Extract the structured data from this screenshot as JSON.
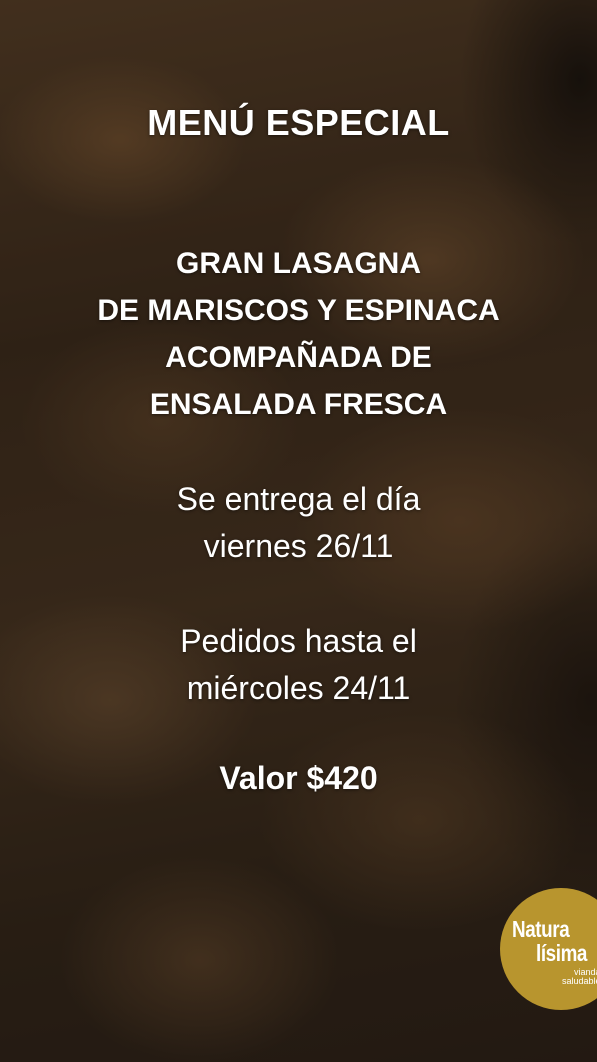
{
  "menu": {
    "title": "MENÚ ESPECIAL",
    "dish_lines": [
      "GRAN LASAGNA",
      "DE MARISCOS Y ESPINACA",
      "ACOMPAÑADA DE",
      "ENSALADA FRESCA"
    ],
    "delivery_lines": [
      "Se entrega el día",
      "viernes 26/11"
    ],
    "orders_lines": [
      "Pedidos hasta el",
      "miércoles 24/11"
    ],
    "price": "Valor $420"
  },
  "logo": {
    "line1": "Natura",
    "line2": "lísima",
    "tagline1": "viandas",
    "tagline2": "saludables"
  },
  "colors": {
    "text": "#ffffff",
    "logo_gold": "#b8952e"
  }
}
